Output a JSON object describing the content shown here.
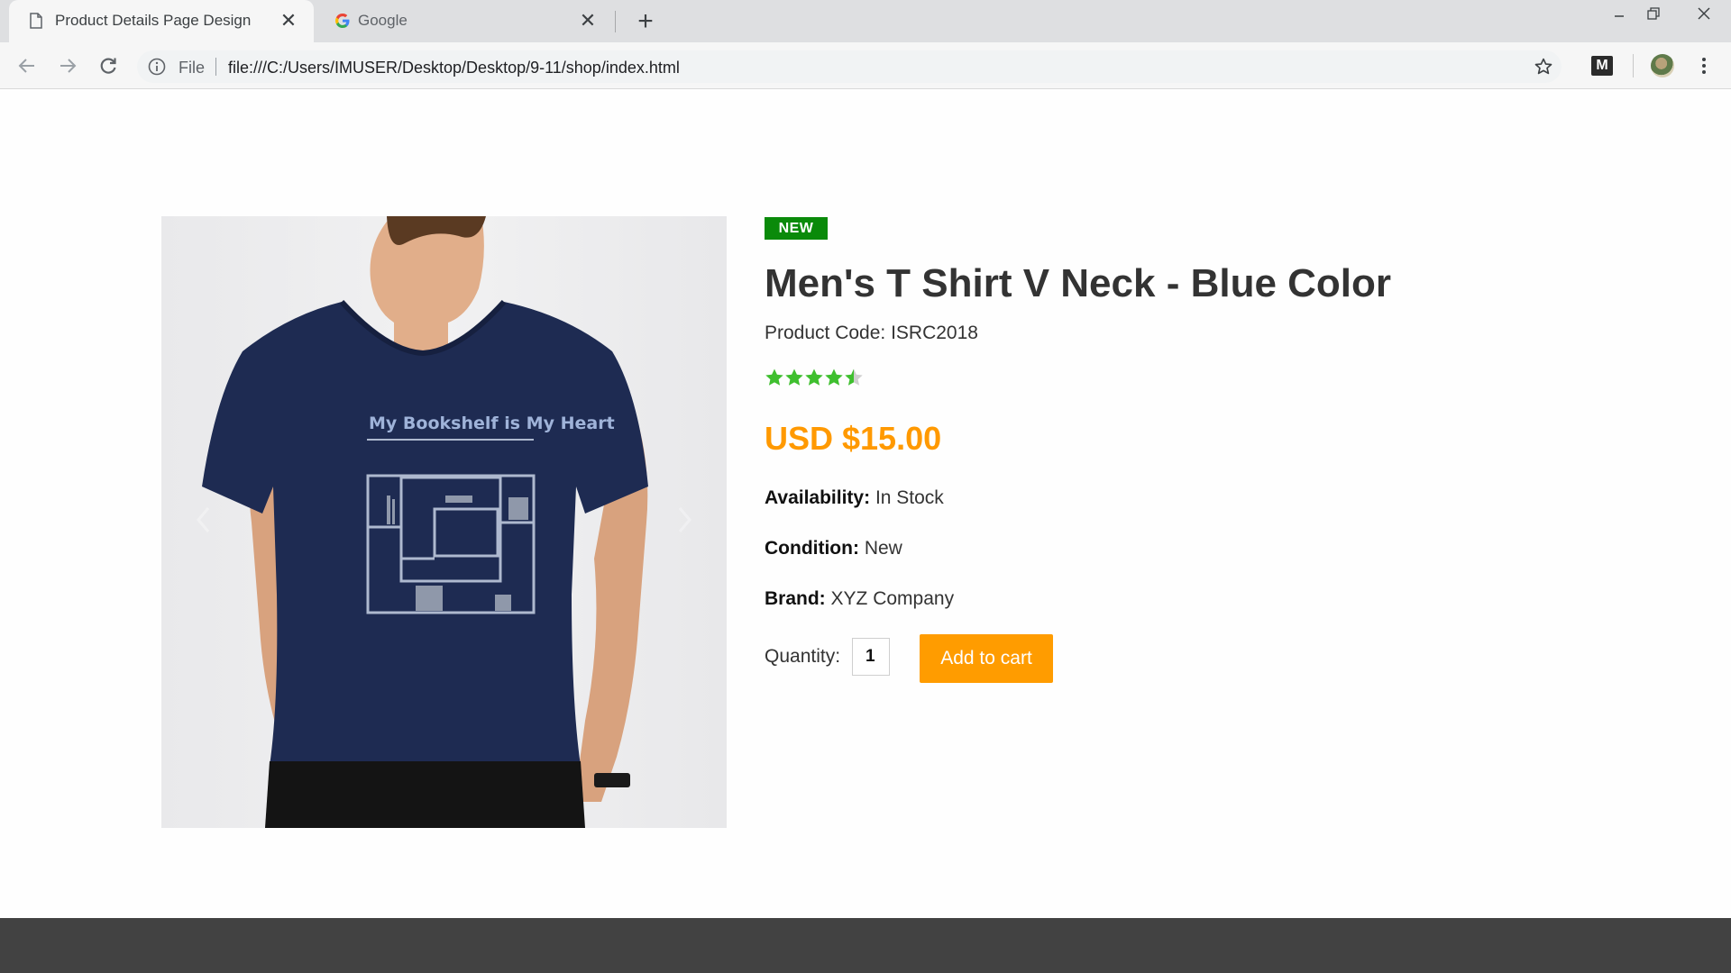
{
  "browser": {
    "tabs": [
      {
        "title": "Product Details Page Design",
        "active": true
      },
      {
        "title": "Google",
        "active": false
      }
    ],
    "omnibox": {
      "scheme_label": "File",
      "url": "file:///C:/Users/IMUSER/Desktop/Desktop/9-11/shop/index.html"
    },
    "extension_label": "M"
  },
  "product": {
    "badge": "NEW",
    "title": "Men's T Shirt V Neck - Blue Color",
    "code": "Product Code: ISRC2018",
    "rating": 4.5,
    "rating_max": 5,
    "price": "USD $15.00",
    "availability_label": "Availability:",
    "availability_value": "In Stock",
    "condition_label": "Condition:",
    "condition_value": "New",
    "brand_label": "Brand:",
    "brand_value": "XYZ Company",
    "quantity_label": "Quantity:",
    "quantity_value": "1",
    "add_to_cart_label": "Add to cart",
    "image": {
      "print_text": "My Bookshelf is My Heart",
      "shirt_color": "#1e2b52"
    }
  },
  "colors": {
    "price": "#ff9900",
    "badge": "#0a8a0a",
    "button": "#ff9c00",
    "stars": "#3fbf2f",
    "footer": "#424242"
  }
}
